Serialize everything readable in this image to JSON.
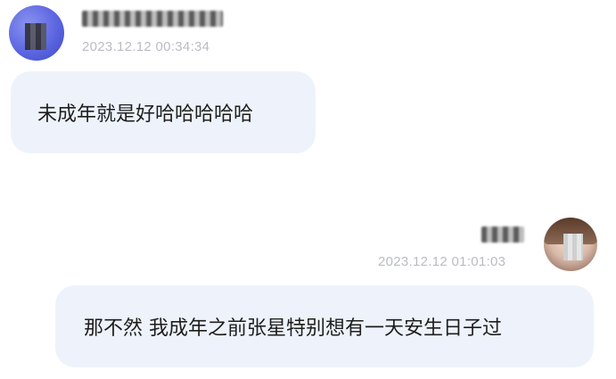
{
  "conversation": {
    "message_left": {
      "sender_name": "",
      "timestamp": "2023.12.12 00:34:34",
      "text": "未成年就是好哈哈哈哈哈"
    },
    "message_right": {
      "sender_name": "",
      "timestamp": "2023.12.12 01:01:03",
      "text": "那不然 我成年之前张星特别想有一天安生日子过"
    }
  },
  "colors": {
    "bubble_background": "#eef3fb",
    "timestamp_text": "#b9bcc3",
    "message_text": "#1e1e1e",
    "left_avatar": "#5c66e0"
  }
}
